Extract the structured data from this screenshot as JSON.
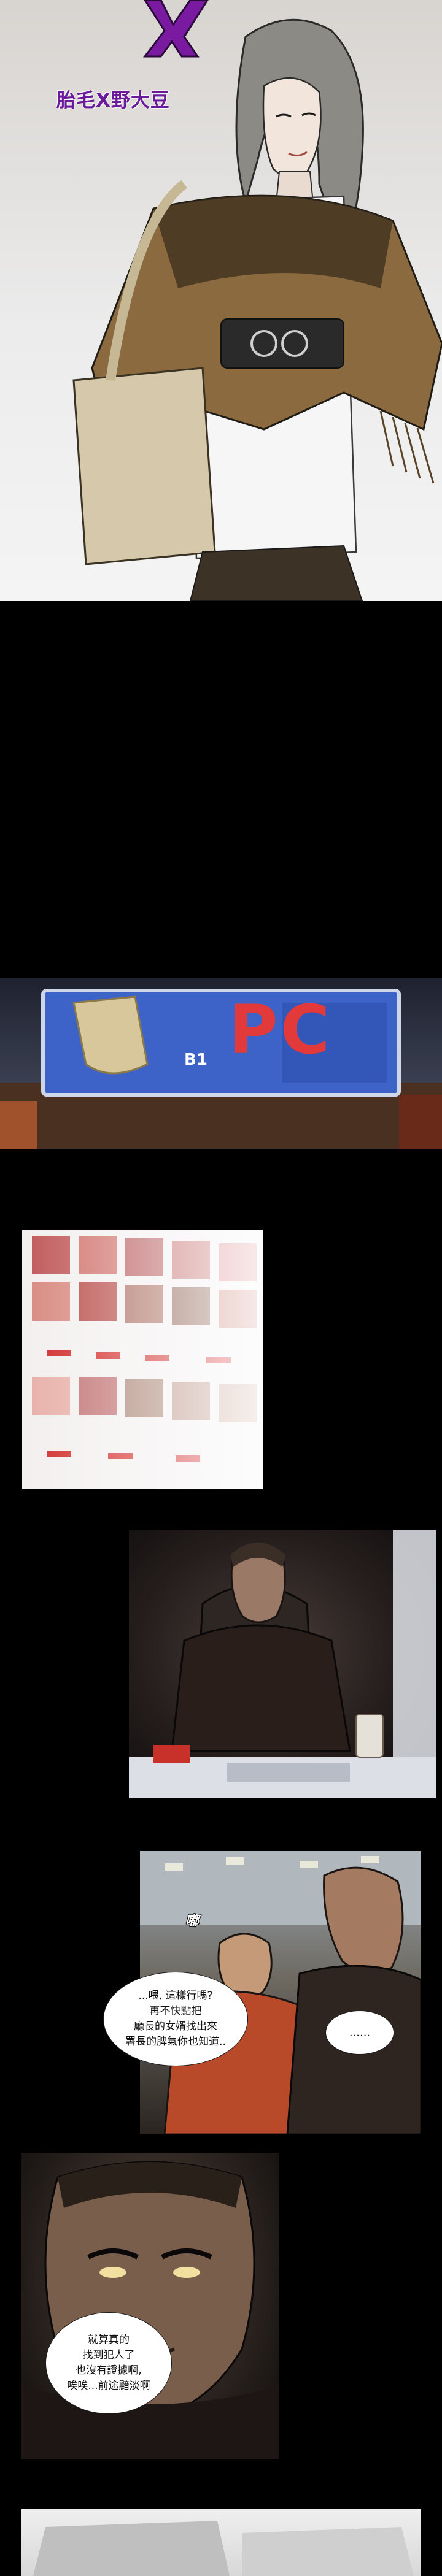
{
  "title": {
    "series_title": "胎毛X野大豆",
    "colors": {
      "title_purple": "#6a1a9a",
      "background_black": "#000000"
    }
  },
  "signage": {
    "pc_sign": "PC",
    "floor_label": "B1"
  },
  "sound_effects": {
    "phone_sfx": "嘟"
  },
  "dialogue": {
    "call_bubble": [
      "...喂, 這樣行嗎?",
      "再不快點把",
      "廳長的女婿找出來",
      "署長的脾氣你也知道.."
    ],
    "silence_bubble": "......",
    "face_bubble": [
      "就算真的",
      "找到犯人了",
      "也沒有證據啊,",
      "唉唉...前途黯淡啊"
    ]
  }
}
